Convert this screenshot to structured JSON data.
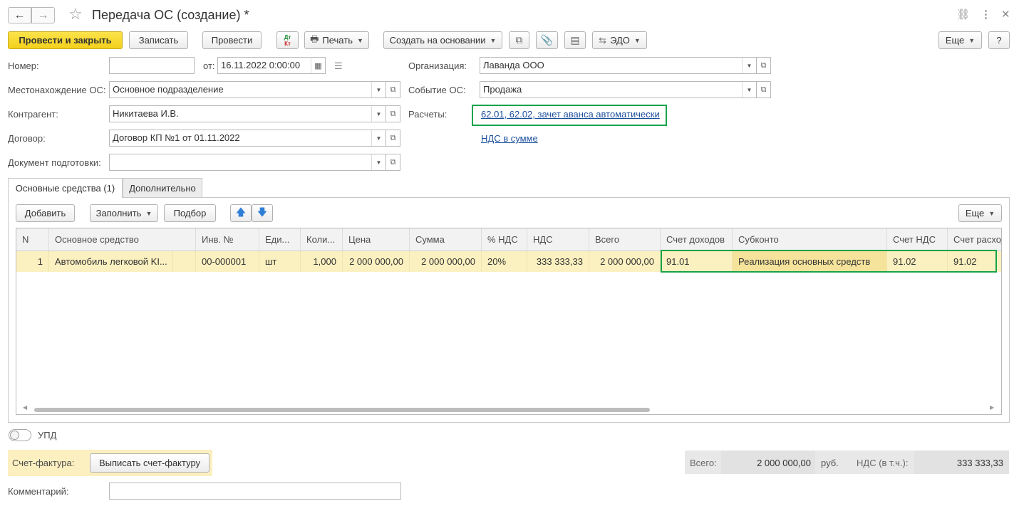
{
  "window": {
    "title": "Передача ОС (создание) *",
    "nav_back": "←",
    "nav_forward": "→",
    "star": "☆",
    "link_icon": "⛓",
    "menu_icon": "⋮",
    "close_icon": "✕"
  },
  "toolbar": {
    "post_close": "Провести и закрыть",
    "save": "Записать",
    "post": "Провести",
    "dt_kt_top": "Дт",
    "dt_kt_bottom": "Кт",
    "print": "Печать",
    "create_based": "Создать на основании",
    "edo": "ЭДО",
    "more": "Еще",
    "help": "?"
  },
  "form": {
    "number_label": "Номер:",
    "number_value": "",
    "from_label": "от:",
    "date_value": "16.11.2022  0:00:00",
    "location_label": "Местонахождение ОС:",
    "location_value": "Основное подразделение",
    "counterparty_label": "Контрагент:",
    "counterparty_value": "Никитаева И.В.",
    "contract_label": "Договор:",
    "contract_value": "Договор КП №1 от 01.11.2022",
    "prep_doc_label": "Документ подготовки:",
    "prep_doc_value": "",
    "org_label": "Организация:",
    "org_value": "Лаванда ООО",
    "event_label": "Событие ОС:",
    "event_value": "Продажа",
    "settlements_label": "Расчеты:",
    "settlements_link": "62.01, 62.02, зачет аванса автоматически",
    "vat_link": "НДС в сумме"
  },
  "tabs": [
    {
      "label": "Основные средства (1)",
      "active": true
    },
    {
      "label": "Дополнительно",
      "active": false
    }
  ],
  "table_toolbar": {
    "add": "Добавить",
    "fill": "Заполнить",
    "select": "Подбор",
    "up_icon": "🡅",
    "down_icon": "🡇",
    "more": "Еще"
  },
  "table": {
    "headers": [
      "N",
      "Основное средство",
      "Инв. №",
      "Еди...",
      "Коли...",
      "Цена",
      "Сумма",
      "% НДС",
      "НДС",
      "Всего",
      "Счет доходов",
      "Субконто",
      "Счет НДС",
      "Счет расходов"
    ],
    "rows": [
      [
        "1",
        "Автомобиль легковой KI...",
        "00-000001",
        "шт",
        "1,000",
        "2 000 000,00",
        "2 000 000,00",
        "20%",
        "333 333,33",
        "2 000 000,00",
        "91.01",
        "Реализация основных средств",
        "91.02",
        "91.02"
      ]
    ]
  },
  "upd_label": "УПД",
  "invoice": {
    "label": "Счет-фактура:",
    "button": "Выписать счет-фактуру"
  },
  "totals": {
    "total_label": "Всего:",
    "total_value": "2 000 000,00",
    "currency": "руб.",
    "vat_label": "НДС (в т.ч.):",
    "vat_value": "333 333,33"
  },
  "comment": {
    "label": "Комментарий:",
    "value": ""
  },
  "colors": {
    "primary_button": "#f3d01c",
    "selected_row": "#fbf0c0",
    "highlight_frame": "#17a34a",
    "link": "#1b4f9c"
  }
}
